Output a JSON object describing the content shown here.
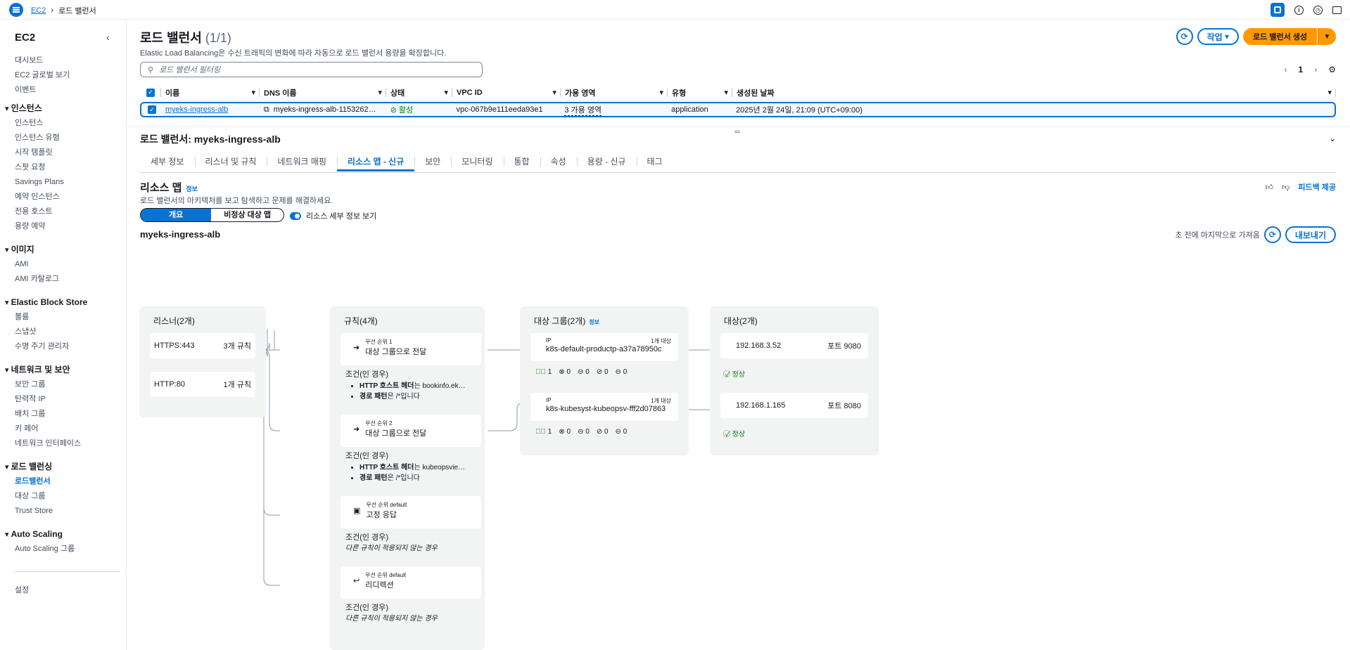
{
  "topbar": {
    "breadcrumb_root": "EC2",
    "breadcrumb_current": "로드 밸런서"
  },
  "sidebar": {
    "title": "EC2",
    "top_items": [
      "대시보드",
      "EC2 글로벌 보기",
      "이벤트"
    ],
    "sections": [
      {
        "label": "인스턴스",
        "items": [
          "인스턴스",
          "인스턴스 유형",
          "시작 템플릿",
          "스팟 요청",
          "Savings Plans",
          "예약 인스턴스",
          "전용 호스트",
          "용량 예약"
        ]
      },
      {
        "label": "이미지",
        "items": [
          "AMI",
          "AMI 카탈로그"
        ]
      },
      {
        "label": "Elastic Block Store",
        "items": [
          "볼륨",
          "스냅샷",
          "수명 주기 관리자"
        ]
      },
      {
        "label": "네트워크 및 보안",
        "items": [
          "보안 그룹",
          "탄력적 IP",
          "배치 그룹",
          "키 페어",
          "네트워크 인터페이스"
        ]
      },
      {
        "label": "로드 밸런싱",
        "items": [
          "로드밸런서",
          "대상 그룹",
          "Trust Store"
        ]
      },
      {
        "label": "Auto Scaling",
        "items": [
          "Auto Scaling 그룹"
        ]
      }
    ],
    "active_item": "로드밸런서",
    "settings": "설정"
  },
  "header": {
    "title": "로드 밸런서",
    "count": "(1/1)",
    "subtitle": "Elastic Load Balancing은 수신 트래픽의 변화에 따라 자동으로 로드 밸런서 용량을 확장합니다.",
    "actions_label": "작업",
    "create_label": "로드 밸런서 생성",
    "filter_placeholder": "로드 밸런서 필터링",
    "page": "1"
  },
  "table": {
    "columns": [
      "이름",
      "DNS 이름",
      "상태",
      "VPC ID",
      "가용 영역",
      "유형",
      "생성된 날짜"
    ],
    "row": {
      "name": "myeks-ingress-alb",
      "dns": "myeks-ingress-alb-1153262…",
      "state": "활성",
      "vpc": "vpc-067b9e111eeda93e1",
      "az": "3 가용 영역",
      "type": "application",
      "created": "2025년 2월 24일, 21:09 (UTC+09:00)"
    }
  },
  "detail": {
    "title": "로드 밸런서: myeks-ingress-alb",
    "tabs": [
      "세부 정보",
      "리스너 및 규칙",
      "네트워크 매핑",
      "리소스 맵 - 신규",
      "보안",
      "모니터링",
      "통합",
      "속성",
      "용량 - 신규",
      "태그"
    ],
    "active_tab": "리소스 맵 - 신규"
  },
  "resource_map": {
    "title": "리소스 맵",
    "info": "정보",
    "subtitle": "로드 밸런서의 아키텍처를 보고 탐색하고 문제를 해결하세요.",
    "feedback": "피드백 제공",
    "seg_overview": "개요",
    "seg_unhealthy": "비정상 대상 맵",
    "toggle_label": "리소스 세부 정보 보기",
    "lb_name": "myeks-ingress-alb",
    "fetched": "초 전에 마지막으로 가져옴",
    "export": "내보내기",
    "listeners": {
      "header": "리스너(2개)",
      "items": [
        {
          "name": "HTTPS:443",
          "rules": "3개 규칙"
        },
        {
          "name": "HTTP:80",
          "rules": "1개 규칙"
        }
      ]
    },
    "rules": {
      "header": "규칙(4개)",
      "cond_label": "조건(인 경우)",
      "items": [
        {
          "priority": "우선 순위 1",
          "action": "대상 그룹으로 전달",
          "conds": [
            [
              "HTTP 호스트 헤더",
              "는 bookinfo.ek…"
            ],
            [
              "경로 패턴",
              "은 /*입니다"
            ]
          ]
        },
        {
          "priority": "우선 순위 2",
          "action": "대상 그룹으로 전달",
          "conds": [
            [
              "HTTP 호스트 헤더",
              "는 kubeopsvie…"
            ],
            [
              "경로 패턴",
              "은 /*입니다"
            ]
          ]
        },
        {
          "priority": "우선 순위 default",
          "action": "고정 응답",
          "default_cond": "다른 규칙이 적용되지 않는 경우"
        },
        {
          "priority": "우선 순위 default",
          "action": "리디렉션",
          "default_cond": "다른 규칙이 적용되지 않는 경우"
        }
      ]
    },
    "target_groups": {
      "header": "대상 그룹(2개)",
      "info": "정보",
      "items": [
        {
          "type": "IP",
          "count": "1개 대상",
          "name": "k8s-default-productp-a37a78950c",
          "stats": [
            "1",
            "0",
            "0",
            "0",
            "0"
          ]
        },
        {
          "type": "IP",
          "count": "1개 대상",
          "name": "k8s-kubesyst-kubeopsv-fff2d07863",
          "stats": [
            "1",
            "0",
            "0",
            "0",
            "0"
          ]
        }
      ]
    },
    "targets": {
      "header": "대상(2개)",
      "items": [
        {
          "ip": "192.168.3.52",
          "port": "포트 9080",
          "health": "정상"
        },
        {
          "ip": "192.168.1.165",
          "port": "포트 8080",
          "health": "정상"
        }
      ]
    }
  }
}
